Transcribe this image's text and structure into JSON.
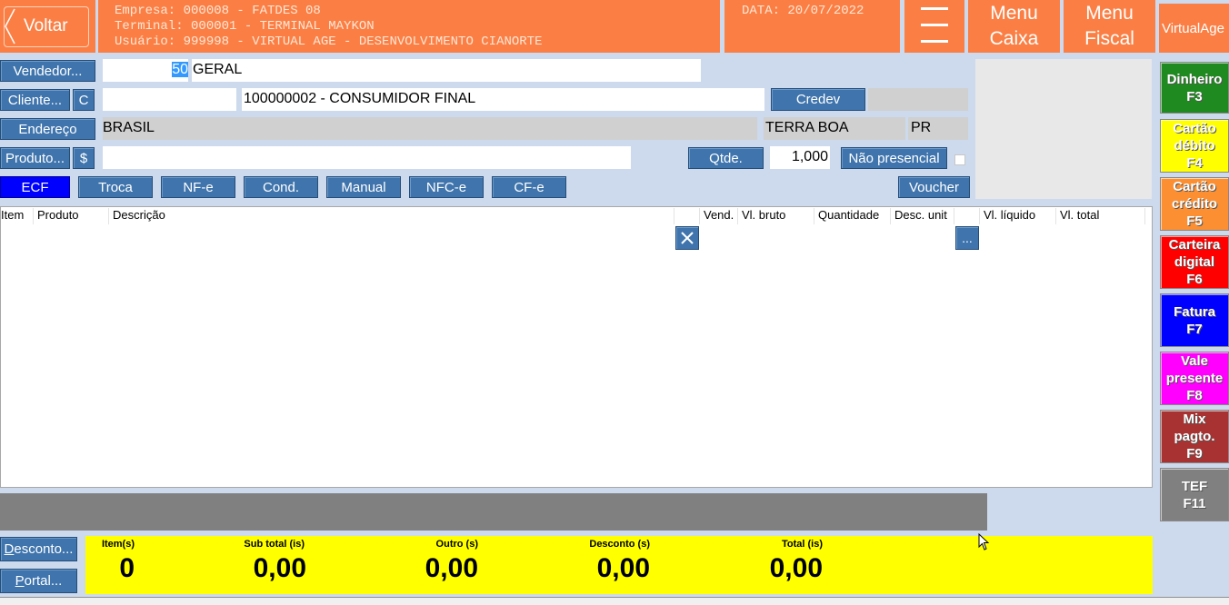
{
  "header": {
    "back_label": "Voltar",
    "company_line": "Empresa: 000008 - FATDES 08",
    "terminal_line": "Terminal: 000001 - TERMINAL MAYKON",
    "user_line": "Usuário: 999998 - VIRTUAL AGE - DESENVOLVIMENTO CIANORTE",
    "date_label": "DATA: 20/07/2022",
    "menu_caixa": "Menu\nCaixa",
    "menu_fiscal": "Menu\nFiscal",
    "brand": "VirtualAge"
  },
  "form": {
    "vendedor_btn": "Vendedor...",
    "vendedor_code": "50",
    "vendedor_name": "GERAL",
    "cliente_btn": "Cliente...",
    "cliente_c_btn": "C",
    "cliente_code": "",
    "cliente_name": "100000002 - CONSUMIDOR FINAL",
    "credev_btn": "Credev",
    "endereco_btn": "Endereço",
    "country": "BRASIL",
    "city": "TERRA BOA",
    "state": "PR",
    "produto_btn": "Produto...",
    "dollar_btn": "$",
    "produto_value": "",
    "qtde_btn": "Qtde.",
    "qtde_value": "1,000",
    "nao_presencial_btn": "Não presencial"
  },
  "doc_buttons": {
    "ecf": "ECF",
    "troca": "Troca",
    "nfe": "NF-e",
    "cond": "Cond.",
    "manual": "Manual",
    "nfce": "NFC-e",
    "cfe": "CF-e",
    "voucher": "Voucher"
  },
  "table": {
    "columns": {
      "item": "Item",
      "produto": "Produto",
      "descricao": "Descrição",
      "vend": "Vend.",
      "vl_bruto": "Vl. bruto",
      "quantidade": "Quantidade",
      "desc_unit": "Desc. unit",
      "vl_liquido": "Vl. líquido",
      "vl_total": "Vl. total"
    },
    "delete_icon": "close-icon",
    "more_btn": "..."
  },
  "payments": [
    {
      "label": "Dinheiro\nF3",
      "color": "#1f8a1f"
    },
    {
      "label": "Cartão\ndébito\nF4",
      "color": "#ffff00"
    },
    {
      "label": "Cartão\ncrédito\nF5",
      "color": "#fb8f32"
    },
    {
      "label": "Carteira\ndigital\nF6",
      "color": "#ff0000"
    },
    {
      "label": "Fatura\nF7",
      "color": "#0000ff"
    },
    {
      "label": "Vale\npresente\nF8",
      "color": "#ff00ff"
    },
    {
      "label": "Mix\npagto.\nF9",
      "color": "#a83232"
    },
    {
      "label": "TEF\nF11",
      "color": "#808080"
    }
  ],
  "footer": {
    "desconto_btn": "Desconto...",
    "portal_btn": "Portal...",
    "items_label": "Item(s)",
    "items_value": "0",
    "subtotal_label": "Sub total (is)",
    "subtotal_value": "0,00",
    "outro_label": "Outro (s)",
    "outro_value": "0,00",
    "desconto_label": "Desconto (s)",
    "desconto_value": "0,00",
    "total_label": "Total (is)",
    "total_value": "0,00"
  },
  "colors": {
    "header_orange": "#fb7f44",
    "button_blue": "#3f74ad",
    "ecf_active": "#0000ff",
    "totals_yellow": "#ffff00",
    "background": "#cdd9ec"
  }
}
